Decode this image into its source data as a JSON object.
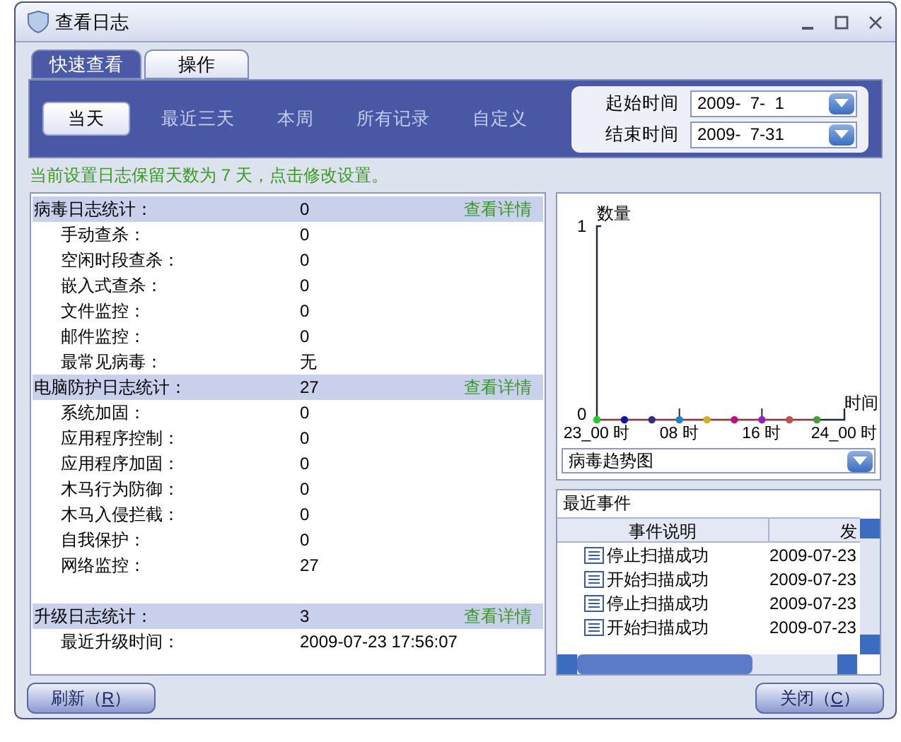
{
  "window": {
    "title": "查看日志"
  },
  "tabs": [
    {
      "label": "快速查看",
      "selected": true
    },
    {
      "label": "操作",
      "selected": false
    }
  ],
  "ranges": [
    {
      "label": "当天",
      "selected": true
    },
    {
      "label": "最近三天",
      "selected": false
    },
    {
      "label": "本周",
      "selected": false
    },
    {
      "label": "所有记录",
      "selected": false
    },
    {
      "label": "自定义",
      "selected": false
    }
  ],
  "dates": [
    {
      "label": "起始时间",
      "value": "2009-  7-  1"
    },
    {
      "label": "结束时间",
      "value": "2009-  7-31"
    }
  ],
  "notice": "当前设置日志保留天数为 7 天，点击修改设置。",
  "stats": [
    {
      "kind": "header",
      "label": "病毒日志统计：",
      "value": "0",
      "link": "查看详情"
    },
    {
      "kind": "item",
      "label": "手动查杀：",
      "value": "0"
    },
    {
      "kind": "item",
      "label": "空闲时段查杀：",
      "value": "0"
    },
    {
      "kind": "item",
      "label": "嵌入式查杀：",
      "value": "0"
    },
    {
      "kind": "item",
      "label": "文件监控：",
      "value": "0"
    },
    {
      "kind": "item",
      "label": "邮件监控：",
      "value": "0"
    },
    {
      "kind": "item",
      "label": "最常见病毒：",
      "value": "无"
    },
    {
      "kind": "header",
      "label": "电脑防护日志统计：",
      "value": "27",
      "link": "查看详情"
    },
    {
      "kind": "item",
      "label": "系统加固：",
      "value": "0"
    },
    {
      "kind": "item",
      "label": "应用程序控制：",
      "value": "0"
    },
    {
      "kind": "item",
      "label": "应用程序加固：",
      "value": "0"
    },
    {
      "kind": "item",
      "label": "木马行为防御：",
      "value": "0"
    },
    {
      "kind": "item",
      "label": "木马入侵拦截：",
      "value": "0"
    },
    {
      "kind": "item",
      "label": "自我保护：",
      "value": "0"
    },
    {
      "kind": "item",
      "label": "网络监控：",
      "value": "27"
    },
    {
      "kind": "gap"
    },
    {
      "kind": "header",
      "label": "升级日志统计：",
      "value": "3",
      "link": "查看详情"
    },
    {
      "kind": "item",
      "label": "最近升级时间：",
      "value": "2009-07-23 17:56:07"
    }
  ],
  "chart": {
    "chart_data": {
      "type": "line",
      "xlabel": "时间",
      "ylabel": "数量",
      "x": [
        0,
        2.67,
        5.33,
        8,
        10.67,
        13.33,
        16,
        18.67,
        21.33
      ],
      "xlim": [
        0,
        24
      ],
      "ylim": [
        0,
        1
      ],
      "yticks": [
        0,
        1
      ],
      "xticks": [
        {
          "value": 0,
          "label": "23_00 时"
        },
        {
          "value": 8,
          "label": "08 时"
        },
        {
          "value": 16,
          "label": "16 时"
        },
        {
          "value": 24,
          "label": "24_00 时"
        }
      ],
      "series": [
        {
          "color": "#a03030",
          "marker": true,
          "values": [
            0,
            0,
            0,
            0,
            0,
            0,
            0,
            0,
            0
          ]
        }
      ]
    },
    "points": [
      {
        "color": "#22cc22"
      },
      {
        "color": "#1010b0"
      },
      {
        "color": "#303080"
      },
      {
        "color": "#2080d0"
      },
      {
        "color": "#d0b020"
      },
      {
        "color": "#c01080"
      },
      {
        "color": "#9020c0"
      },
      {
        "color": "#c05050"
      },
      {
        "color": "#40a030"
      }
    ],
    "selector": "病毒趋势图"
  },
  "events": {
    "title": "最近事件",
    "columns": [
      "事件说明",
      "发"
    ],
    "rows": [
      {
        "name": "停止扫描成功",
        "date": "2009-07-23"
      },
      {
        "name": "开始扫描成功",
        "date": "2009-07-23"
      },
      {
        "name": "停止扫描成功",
        "date": "2009-07-23"
      },
      {
        "name": "开始扫描成功",
        "date": "2009-07-23"
      }
    ]
  },
  "buttons": [
    {
      "label": "刷新（",
      "key": "R",
      "end": "）"
    },
    {
      "label": "关闭（",
      "key": "C",
      "end": "）"
    }
  ]
}
